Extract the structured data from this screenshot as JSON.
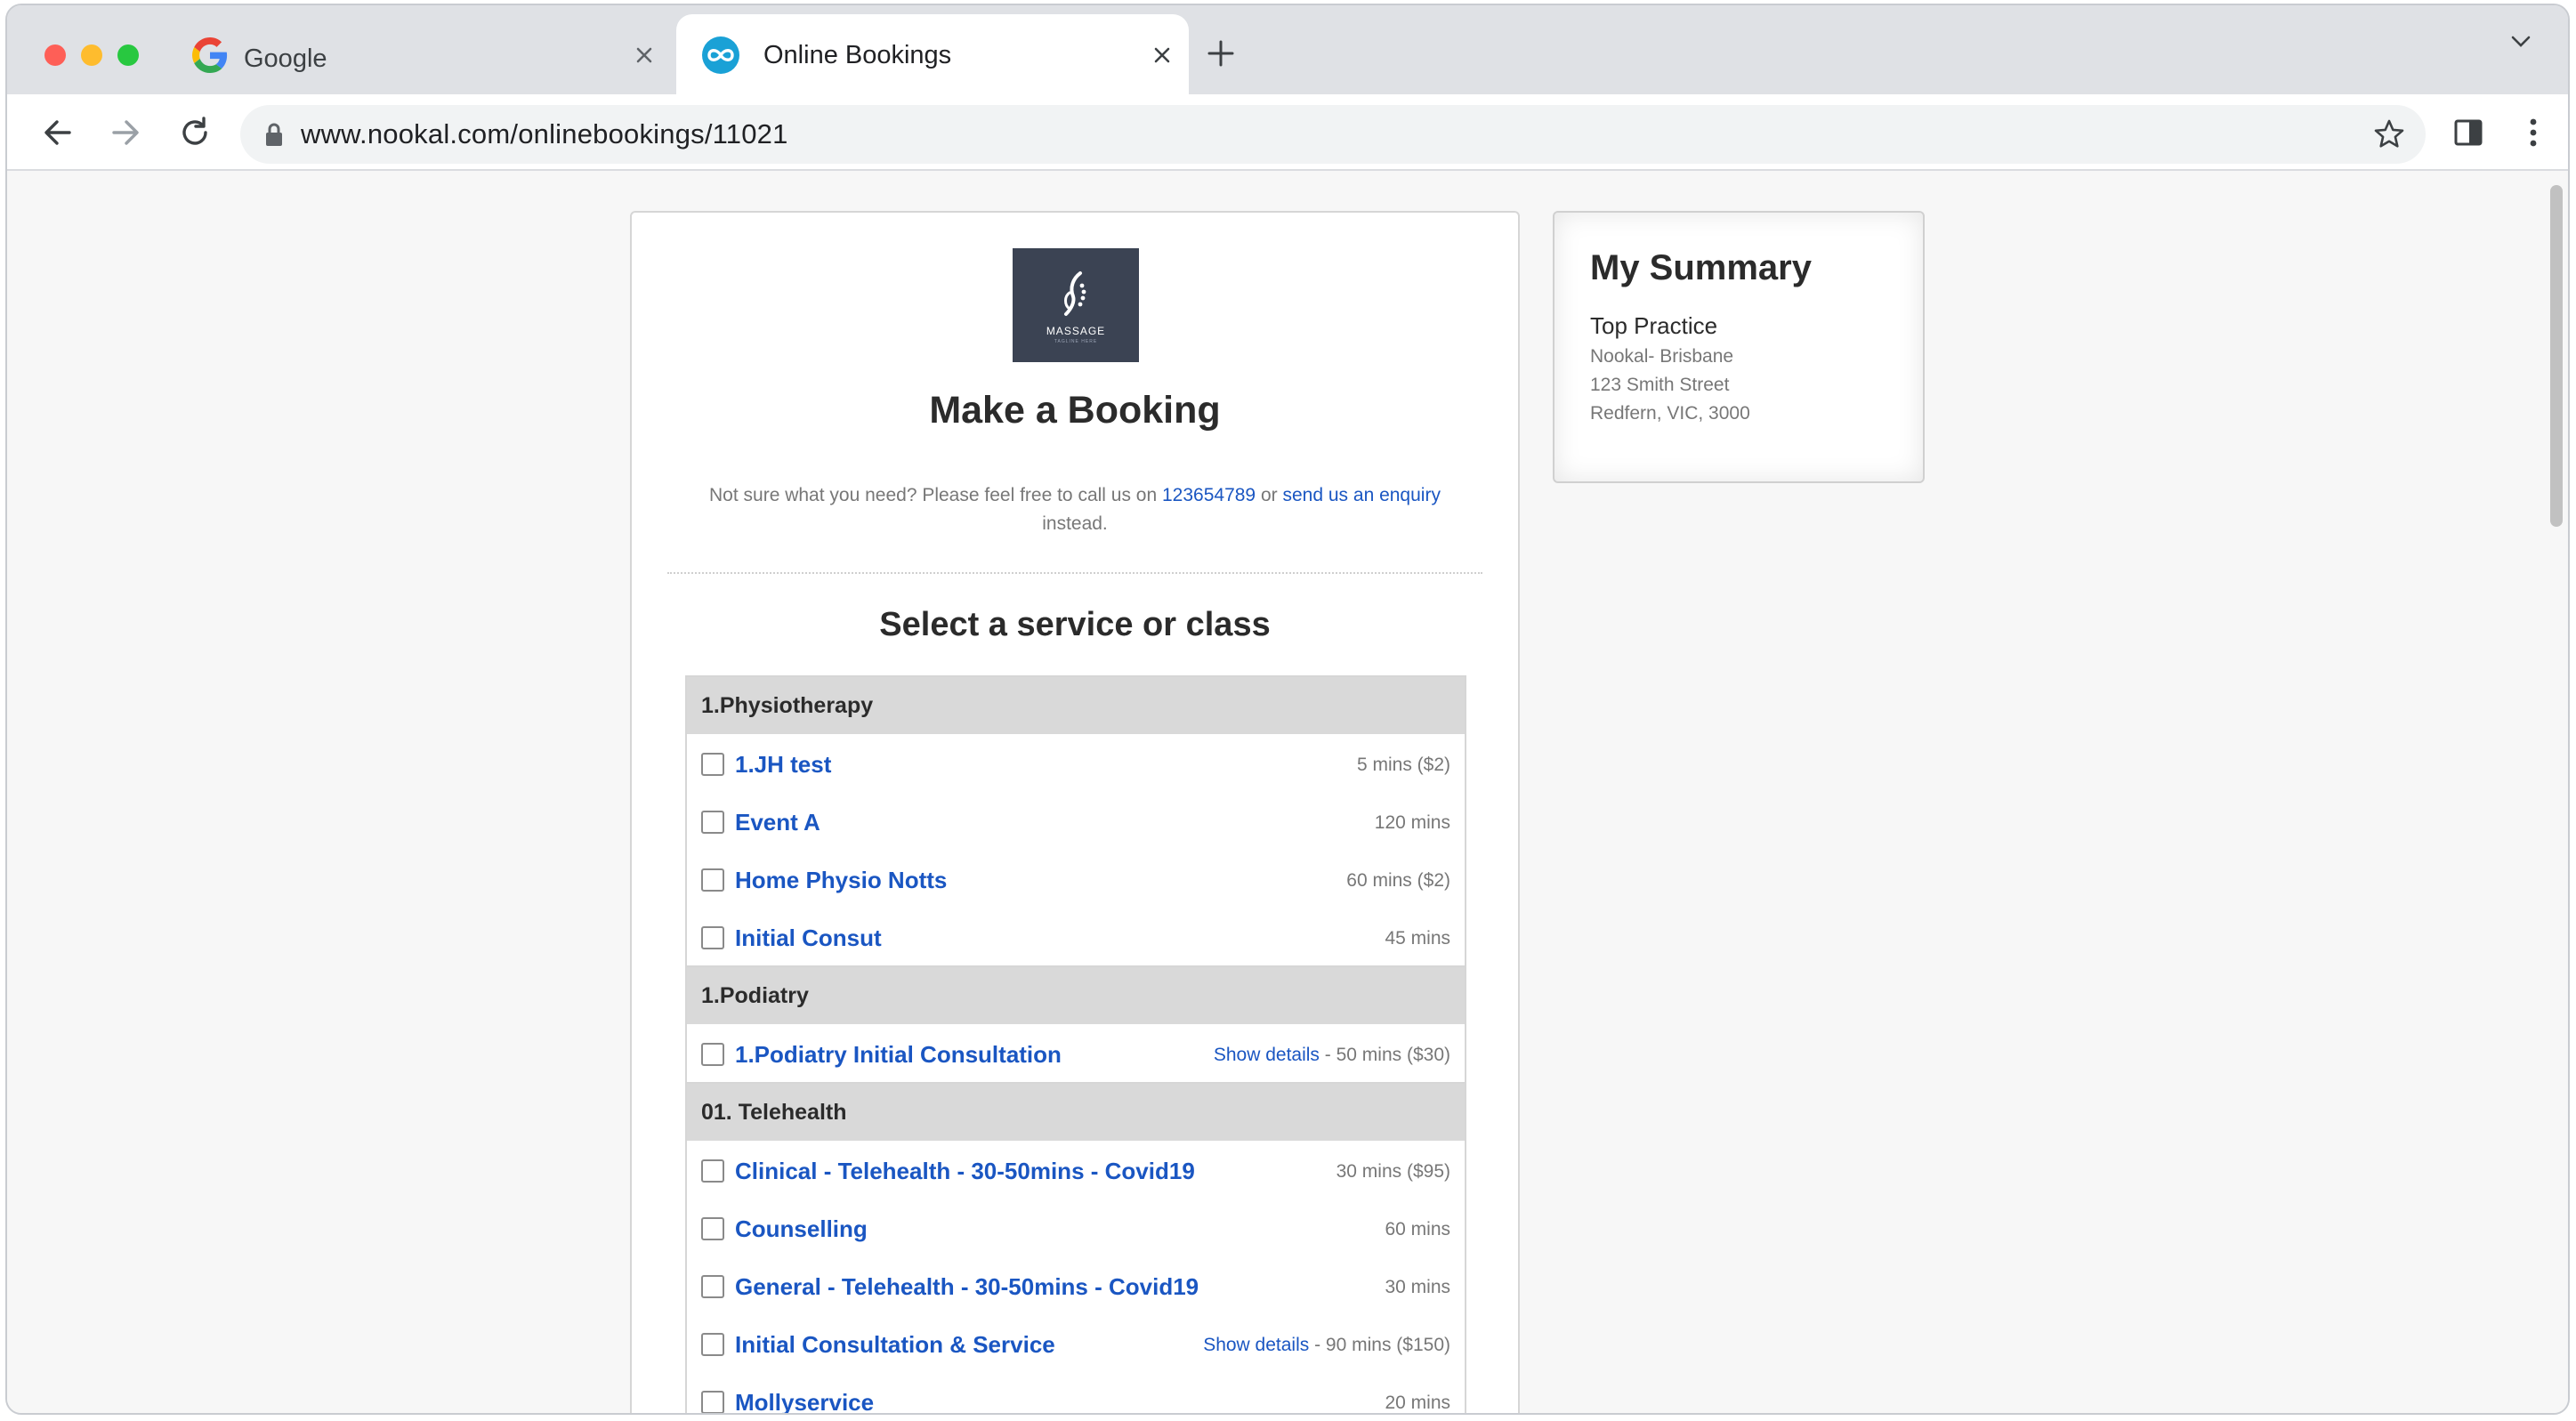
{
  "browser": {
    "tabs": [
      {
        "title": "Google",
        "active": false,
        "icon": "google-g-icon"
      },
      {
        "title": "Online Bookings",
        "active": true,
        "icon": "nookal-infinity-icon"
      }
    ],
    "url": "www.nookal.com/onlinebookings/11021"
  },
  "booking": {
    "logo": {
      "text": "MASSAGE",
      "tagline": "TAGLINE HERE"
    },
    "title": "Make a Booking",
    "note": {
      "prefix": "Not sure what you need? Please feel free to call us on",
      "phone": "123654789",
      "middle": "or",
      "enquiry_link": "send us an enquiry",
      "suffix": "instead."
    },
    "select_heading": "Select a service or class",
    "groups": [
      {
        "name": "1.Physiotherapy",
        "items": [
          {
            "name": "1.JH test",
            "details": "",
            "meta": "5 mins ($2)"
          },
          {
            "name": "Event A",
            "details": "",
            "meta": "120 mins"
          },
          {
            "name": "Home Physio Notts",
            "details": "",
            "meta": "60 mins ($2)"
          },
          {
            "name": "Initial Consut",
            "details": "",
            "meta": "45 mins"
          }
        ]
      },
      {
        "name": "1.Podiatry",
        "items": [
          {
            "name": "1.Podiatry Initial Consultation",
            "details": "Show details",
            "meta": " - 50 mins ($30)"
          }
        ]
      },
      {
        "name": "01. Telehealth",
        "items": [
          {
            "name": "Clinical - Telehealth - 30-50mins - Covid19",
            "details": "",
            "meta": "30 mins ($95)"
          },
          {
            "name": "Counselling",
            "details": "",
            "meta": "60 mins"
          },
          {
            "name": "General - Telehealth - 30-50mins - Covid19",
            "details": "",
            "meta": "30 mins"
          },
          {
            "name": "Initial Consultation & Service",
            "details": "Show details",
            "meta": " - 90 mins ($150)"
          },
          {
            "name": "Mollyservice",
            "details": "",
            "meta": "20 mins"
          }
        ]
      }
    ]
  },
  "summary": {
    "title": "My Summary",
    "practice": "Top Practice",
    "address_lines": [
      "Nookal- Brisbane",
      "123 Smith Street",
      "Redfern, VIC, 3000"
    ]
  },
  "colors": {
    "link": "#1a56c2",
    "group_header_bg": "#d9d9d9",
    "logo_bg": "#3b4353"
  }
}
